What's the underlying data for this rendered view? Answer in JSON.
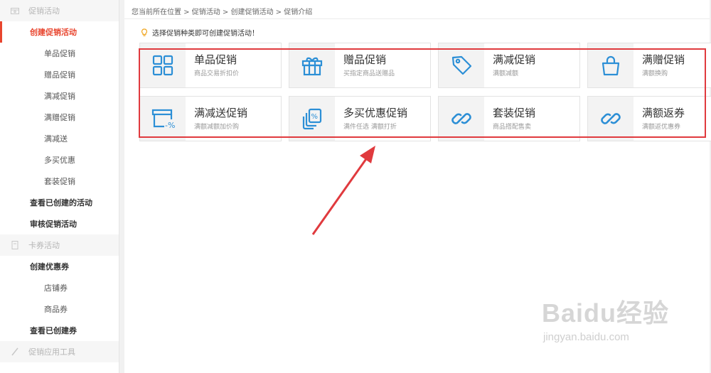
{
  "sidebar": {
    "sections": [
      {
        "header": "促销活动",
        "icon": "promo-icon",
        "items": [
          {
            "label": "创建促销活动",
            "type": "main",
            "active": true
          },
          {
            "label": "单品促销",
            "type": "sub"
          },
          {
            "label": "赠品促销",
            "type": "sub"
          },
          {
            "label": "满减促销",
            "type": "sub"
          },
          {
            "label": "满赠促销",
            "type": "sub"
          },
          {
            "label": "满减送",
            "type": "sub"
          },
          {
            "label": "多买优惠",
            "type": "sub"
          },
          {
            "label": "套装促销",
            "type": "sub"
          },
          {
            "label": "查看已创建的活动",
            "type": "main"
          },
          {
            "label": "审核促销活动",
            "type": "main"
          }
        ]
      },
      {
        "header": "卡券活动",
        "icon": "coupon-icon",
        "items": [
          {
            "label": "创建优惠券",
            "type": "main"
          },
          {
            "label": "店铺券",
            "type": "sub"
          },
          {
            "label": "商品券",
            "type": "sub"
          },
          {
            "label": "查看已创建券",
            "type": "main"
          }
        ]
      },
      {
        "header": "促销应用工具",
        "icon": "tools-icon",
        "items": []
      }
    ]
  },
  "breadcrumb": "您当前所在位置 > 促销活动 > 创建促销活动 > 促销介绍",
  "tip": "选择促销种类即可创建促销活动！",
  "cards": [
    {
      "title": "单品促销",
      "desc": "商品交易折扣价",
      "icon": "grid-icon"
    },
    {
      "title": "赠品促销",
      "desc": "买指定商品送赠品",
      "icon": "gift-icon"
    },
    {
      "title": "满减促销",
      "desc": "满额减额",
      "icon": "tag-icon"
    },
    {
      "title": "满赠促销",
      "desc": "满额换购",
      "icon": "bag-icon"
    },
    {
      "title": "满减送促销",
      "desc": "满额减额加价购",
      "icon": "discount-box-icon"
    },
    {
      "title": "多买优惠促销",
      "desc": "满件任选 满额打折",
      "icon": "percent-cards-icon"
    },
    {
      "title": "套装促销",
      "desc": "商品搭配售卖",
      "icon": "link-icon"
    },
    {
      "title": "满额返券",
      "desc": "满额返优惠券",
      "icon": "link-icon"
    }
  ],
  "colors": {
    "accent": "#e8452e",
    "icon": "#2c8fd6",
    "highlight": "#e03a3e"
  },
  "watermark": {
    "logo": "Baidu经验",
    "url": "jingyan.baidu.com"
  }
}
